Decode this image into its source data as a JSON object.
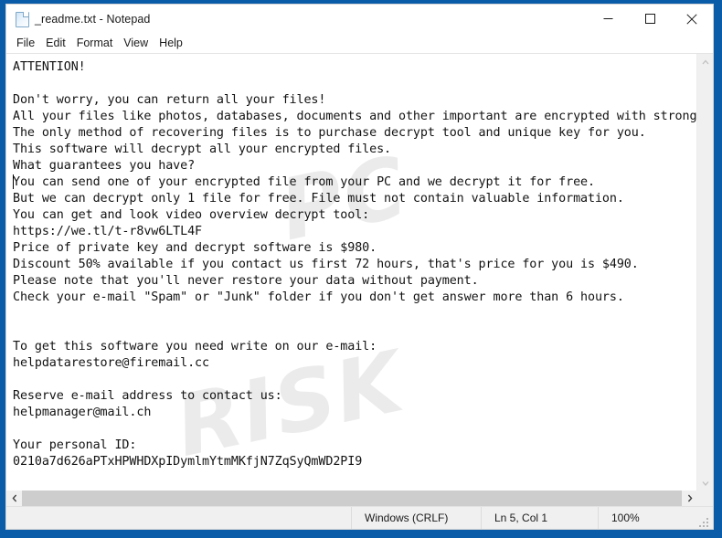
{
  "window": {
    "title": "_readme.txt - Notepad",
    "icon": "notepad-document-icon",
    "minimize_label": "Minimize",
    "maximize_label": "Maximize",
    "close_label": "Close"
  },
  "menubar": {
    "items": [
      {
        "label": "File"
      },
      {
        "label": "Edit"
      },
      {
        "label": "Format"
      },
      {
        "label": "View"
      },
      {
        "label": "Help"
      }
    ]
  },
  "document": {
    "filename": "_readme.txt",
    "body": "ATTENTION!\n\nDon't worry, you can return all your files!\nAll your files like photos, databases, documents and other important are encrypted with strongest encryption and unique key.\nThe only method of recovering files is to purchase decrypt tool and unique key for you.\nThis software will decrypt all your encrypted files.\nWhat guarantees you have?\nYou can send one of your encrypted file from your PC and we decrypt it for free.\nBut we can decrypt only 1 file for free. File must not contain valuable information.\nYou can get and look video overview decrypt tool:\nhttps://we.tl/t-r8vw6LTL4F\nPrice of private key and decrypt software is $980.\nDiscount 50% available if you contact us first 72 hours, that's price for you is $490.\nPlease note that you'll never restore your data without payment.\nCheck your e-mail \"Spam\" or \"Junk\" folder if you don't get answer more than 6 hours.\n\n\nTo get this software you need write on our e-mail:\nhelpdatarestore@firemail.cc\n\nReserve e-mail address to contact us:\nhelpmanager@mail.ch\n\nYour personal ID:\n0210a7d626aPTxHPWHDXpIDymlmYtmMKfjN7ZqSyQmWD2PI9",
    "video_url": "https://we.tl/t-r8vw6LTL4F",
    "price_full": "$980",
    "price_discount": "$490",
    "discount_percent": "50%",
    "discount_window_hours": "72",
    "answer_wait_hours": "6",
    "primary_email": "helpdatarestore@firemail.cc",
    "reserve_email": "helpmanager@mail.ch",
    "personal_id": "0210a7d626aPTxHPWHDXpIDymlmYtmMKfjN7ZqSyQmWD2PI9"
  },
  "watermark": {
    "line1": "PC",
    "line2": "RISK"
  },
  "statusbar": {
    "line_ending": "Windows (CRLF)",
    "cursor_position": "Ln 5, Col 1",
    "zoom": "100%"
  },
  "scrollbars": {
    "up_arrow": "chevron-up-icon",
    "down_arrow": "chevron-down-icon",
    "left_arrow": "chevron-left-icon",
    "right_arrow": "chevron-right-icon"
  },
  "colors": {
    "desktop": "#0b5ca8",
    "window": "#ffffff",
    "chrome": "#f0f0f0",
    "text": "#121212",
    "scroll_thumb": "#cdcdcd"
  }
}
